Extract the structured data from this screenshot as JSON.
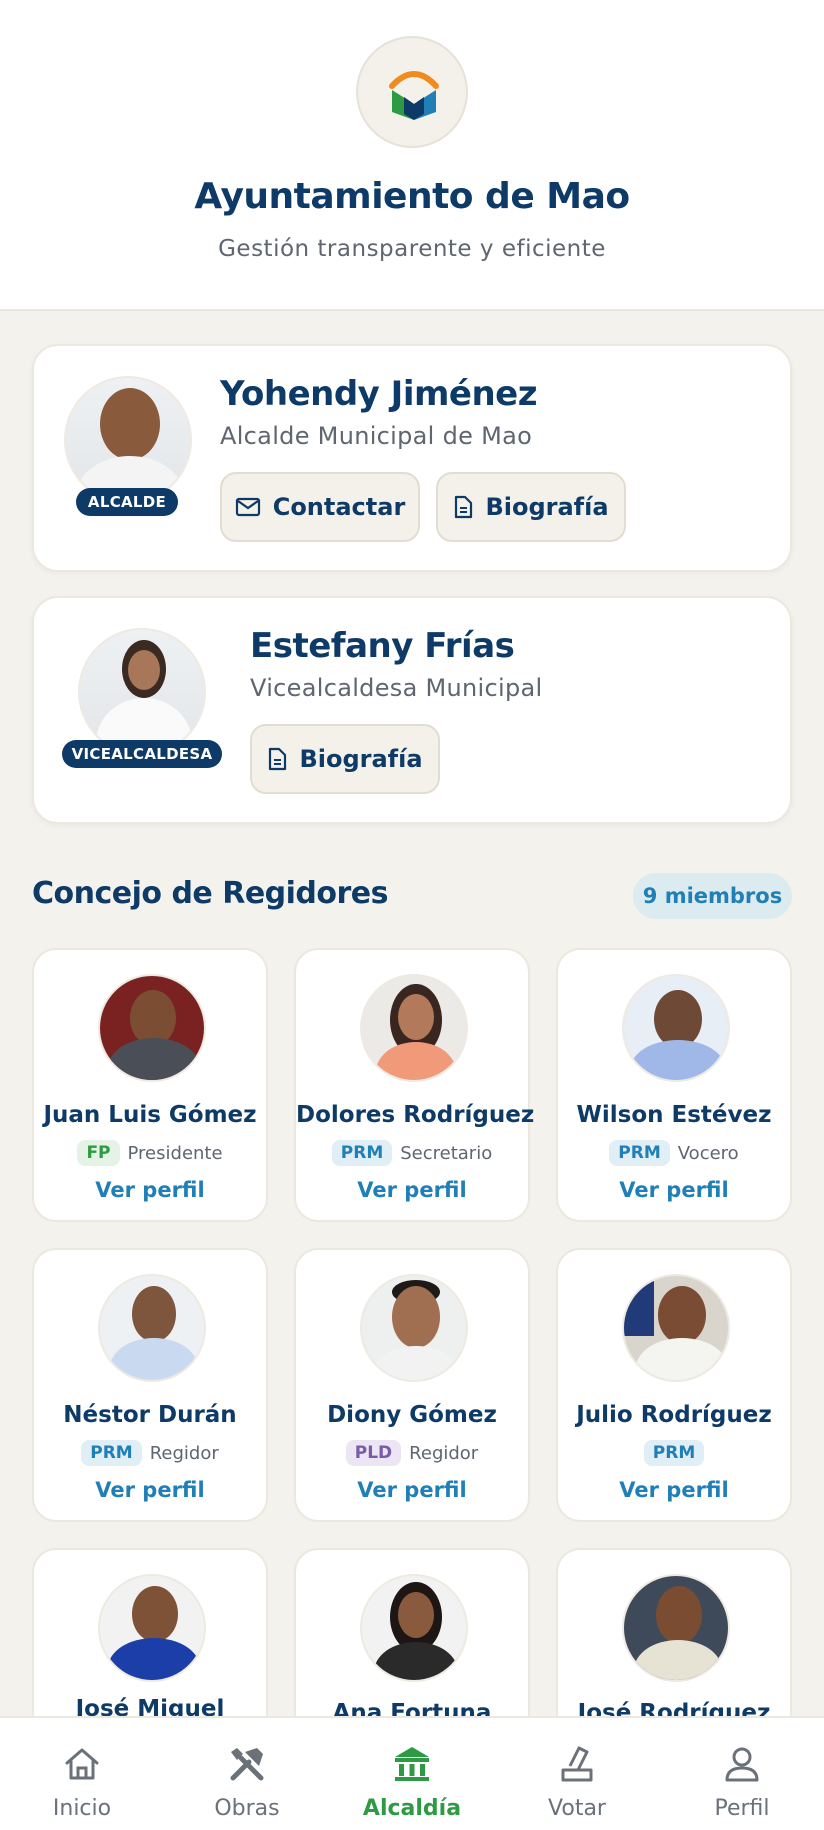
{
  "header": {
    "title": "Ayuntamiento de Mao",
    "subtitle": "Gestión transparente y eficiente"
  },
  "mayor": {
    "name": "Yohendy Jiménez",
    "role": "Alcalde Municipal de Mao",
    "badge": "ALCALDE",
    "contact_label": "Contactar",
    "bio_label": "Biografía"
  },
  "vice_mayor": {
    "name": "Estefany Frías",
    "role": "Vicealcaldesa Municipal",
    "badge": "VICEALCALDESA",
    "bio_label": "Biografía"
  },
  "council": {
    "title": "Concejo de Regidores",
    "count_label": "9 miembros",
    "members": [
      {
        "name": "Juan Luis Gómez",
        "party": "FP",
        "position": "Presidente",
        "link": "Ver perfil"
      },
      {
        "name": "Dolores Rodríguez",
        "party": "PRM",
        "position": "Secretario",
        "link": "Ver perfil"
      },
      {
        "name": "Wilson Estévez",
        "party": "PRM",
        "position": "Vocero",
        "link": "Ver perfil"
      },
      {
        "name": "Néstor Durán",
        "party": "PRM",
        "position": "Regidor",
        "link": "Ver perfil"
      },
      {
        "name": "Diony Gómez",
        "party": "PLD",
        "position": "Regidor",
        "link": "Ver perfil"
      },
      {
        "name": "Julio Rodríguez",
        "party": "PRM",
        "position": "",
        "link": "Ver perfil"
      },
      {
        "name": "José Miguel",
        "party": "",
        "position": "",
        "link": ""
      },
      {
        "name": "Ana Fortuna",
        "party": "",
        "position": "",
        "link": ""
      },
      {
        "name": "José Rodríguez",
        "party": "",
        "position": "",
        "link": ""
      }
    ]
  },
  "nav": {
    "items": [
      {
        "label": "Inicio",
        "icon": "home-icon"
      },
      {
        "label": "Obras",
        "icon": "tools-icon"
      },
      {
        "label": "Alcaldía",
        "icon": "city-hall-icon"
      },
      {
        "label": "Votar",
        "icon": "vote-icon"
      },
      {
        "label": "Perfil",
        "icon": "user-icon"
      }
    ],
    "active": "Alcaldía"
  },
  "colors": {
    "primary": "#0d3a66",
    "accent": "#1f7fb6",
    "active_nav": "#2e9a43",
    "background": "#f4f2ec"
  }
}
